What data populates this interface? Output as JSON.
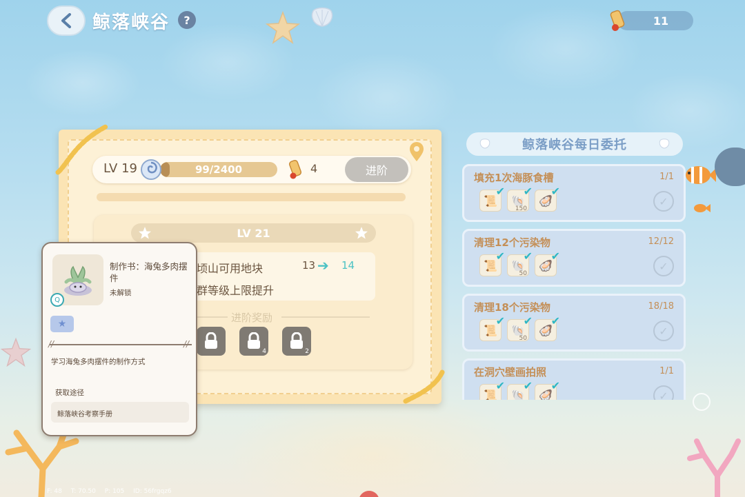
{
  "header": {
    "title": "鲸落峡谷",
    "help_label": "?",
    "currency_count": "11",
    "back_icon": "chevron-left-icon"
  },
  "level_panel": {
    "current_level": "LV 19",
    "exp_text": "99/2400",
    "exp_progress": 0.04125,
    "scroll_count": "4",
    "advance_label": "进阶",
    "advance_enabled": false
  },
  "next_level": {
    "level": "LV 21",
    "upgrades": [
      {
        "text": "顷山可用地块",
        "from": "13",
        "to": "14"
      },
      {
        "text": "群等级上限提升"
      }
    ],
    "rewards_title": "进阶奖励",
    "rewards": [
      {
        "icon": "lock-icon",
        "count": ""
      },
      {
        "icon": "lock-icon",
        "count": "4"
      },
      {
        "icon": "lock-icon",
        "count": "2"
      }
    ]
  },
  "tooltip": {
    "item_name": "制作书：海兔多肉摆件",
    "status": "未解锁",
    "description": "学习海兔多肉摆件的制作方式",
    "source_title": "获取途径",
    "source_text": "鲸落峡谷考察手册"
  },
  "quests": {
    "title": "鲸落峡谷每日委托",
    "items": [
      {
        "name": "填充1次海豚食槽",
        "progress": "1/1",
        "rewards": [
          {
            "icon": "scroll-icon",
            "count": ""
          },
          {
            "icon": "shell-currency-icon",
            "count": "150"
          },
          {
            "icon": "pearl-shell-icon",
            "count": ""
          }
        ]
      },
      {
        "name": "清理12个污染物",
        "progress": "12/12",
        "rewards": [
          {
            "icon": "scroll-icon",
            "count": ""
          },
          {
            "icon": "shell-currency-icon",
            "count": "50"
          },
          {
            "icon": "pearl-shell-icon",
            "count": ""
          }
        ]
      },
      {
        "name": "清理18个污染物",
        "progress": "18/18",
        "rewards": [
          {
            "icon": "scroll-icon",
            "count": ""
          },
          {
            "icon": "shell-currency-icon",
            "count": "50"
          },
          {
            "icon": "pearl-shell-icon",
            "count": ""
          }
        ]
      },
      {
        "name": "在洞穴壁画拍照",
        "progress": "1/1",
        "rewards": [
          {
            "icon": "scroll-icon",
            "count": ""
          },
          {
            "icon": "shell-currency-icon",
            "count": ""
          },
          {
            "icon": "pearl-shell-icon",
            "count": ""
          }
        ]
      }
    ]
  },
  "debug": {
    "f": "F: 48",
    "t": "T: 70.50",
    "p": "P: 105",
    "id": "ID: 56frgqz6"
  },
  "colors": {
    "accent_teal": "#4cc2c4",
    "quest_text": "#c48f57",
    "panel_bg": "#fbe4b4"
  }
}
